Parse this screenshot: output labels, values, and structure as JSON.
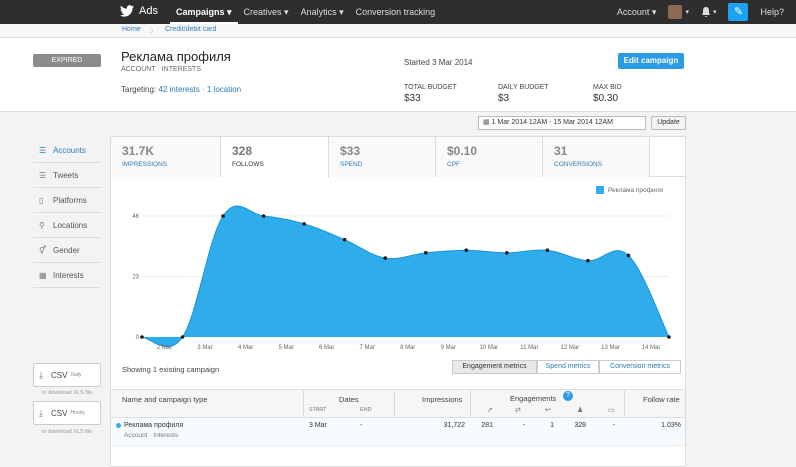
{
  "nav": {
    "brand": "Ads",
    "items": [
      "Campaigns ▾",
      "Creatives ▾",
      "Analytics ▾",
      "Conversion tracking"
    ],
    "account_label": "Account ▾",
    "help": "Help?"
  },
  "breadcrumb": [
    "Home",
    "Credit/debit card"
  ],
  "campaign": {
    "status": "EXPIRED",
    "name": "Реклама профиля",
    "subtitle": "ACCOUNT · INTERESTS",
    "started": "Started 3 Mar 2014",
    "edit_label": "Edit campaign",
    "targeting_label": "Targeting:",
    "targeting_interests": "42 interests",
    "targeting_sep": "·",
    "targeting_locations": "1 location",
    "total_budget_label": "TOTAL BUDGET",
    "total_budget": "$33",
    "daily_budget_label": "DAILY BUDGET",
    "daily_budget": "$3",
    "max_bid_label": "MAX BID",
    "max_bid": "$0.30"
  },
  "date_range": "1 Mar 2014 12AM - 15 Mar 2014 12AM",
  "update_label": "Update",
  "sidebar": [
    {
      "icon": "list-icon",
      "label": "Accounts",
      "glyph": "☰"
    },
    {
      "icon": "list-icon",
      "label": "Tweets",
      "glyph": "☰"
    },
    {
      "icon": "phone-icon",
      "label": "Platforms",
      "glyph": "▯"
    },
    {
      "icon": "pin-icon",
      "label": "Locations",
      "glyph": "⚲"
    },
    {
      "icon": "gender-icon",
      "label": "Gender",
      "glyph": "⚥"
    },
    {
      "icon": "grid-icon",
      "label": "Interests",
      "glyph": "▦"
    }
  ],
  "csv": [
    {
      "label": "CSV",
      "sub": "Daily",
      "xls": "or download XLS file"
    },
    {
      "label": "CSV",
      "sub": "Hourly",
      "xls": "or download XLS file"
    }
  ],
  "metrics": [
    {
      "value": "31.7K",
      "label": "IMPRESSIONS"
    },
    {
      "value": "328",
      "label": "FOLLOWS"
    },
    {
      "value": "$33",
      "label": "SPEND"
    },
    {
      "value": "$0.10",
      "label": "CPF"
    },
    {
      "value": "31",
      "label": "CONVERSIONS"
    }
  ],
  "chart_data": {
    "type": "area",
    "series": [
      {
        "name": "Реклама профиля",
        "values": [
          0,
          0,
          46,
          46,
          43,
          37,
          30,
          32,
          33,
          32,
          33,
          29,
          31,
          0
        ]
      }
    ],
    "x_ticks": [
      "2 Mar",
      "3 Mar",
      "4 Mar",
      "5 Mar",
      "6 Mar",
      "7 Mar",
      "8 Mar",
      "9 Mar",
      "10 Mar",
      "11 Mar",
      "12 Mar",
      "13 Mar",
      "14 Mar"
    ],
    "y_ticks": [
      "0",
      "23",
      "46"
    ],
    "ylim": [
      0,
      46
    ],
    "color": "#2eacec"
  },
  "showing": "Showing 1 existing campaign",
  "metric_buttons": [
    "Engagement metrics",
    "Spend metrics",
    "Conversion metrics"
  ],
  "table": {
    "headers": {
      "name": "Name and campaign type",
      "dates": "Dates",
      "start": "START",
      "end": "END",
      "impressions": "Impressions",
      "engagements": "Engagements",
      "follow_rate": "Follow rate"
    },
    "row": {
      "name": "Реклама профиля",
      "type": "Account · Interests",
      "start": "3 Mar",
      "end": "-",
      "impressions": "31,722",
      "clicks": "281",
      "retweets": "-",
      "replies": "1",
      "follows": "328",
      "cards": "-",
      "follow_rate": "1.03%"
    }
  }
}
